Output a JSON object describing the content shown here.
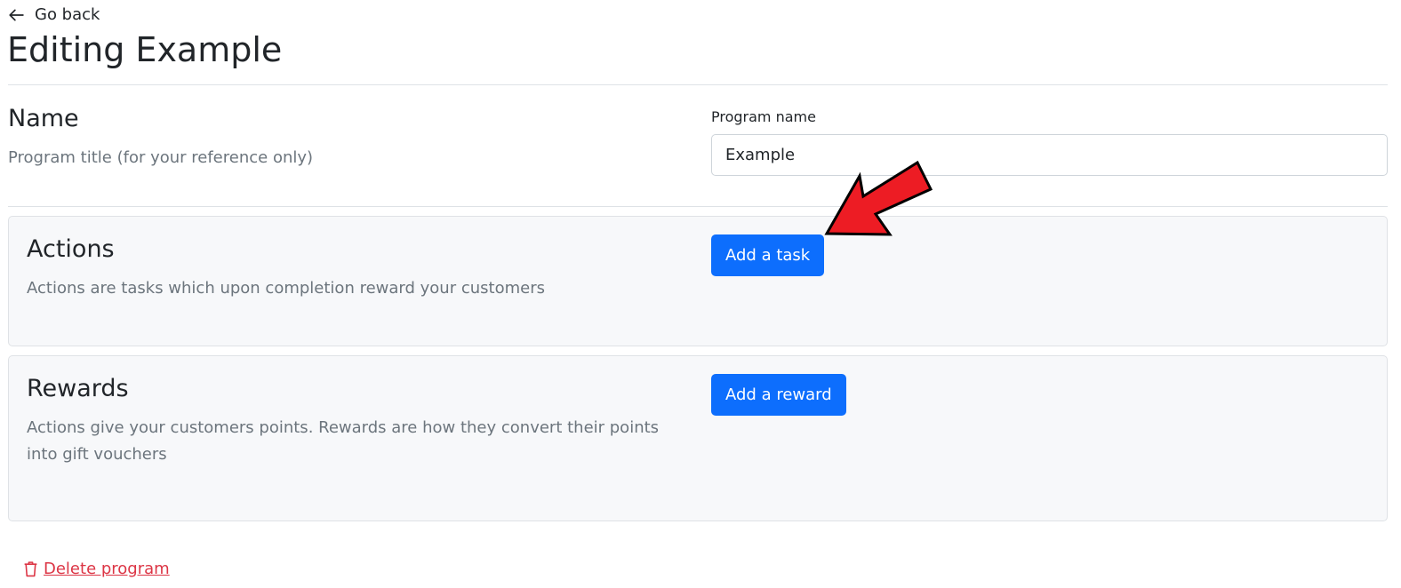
{
  "nav": {
    "back_label": "Go back"
  },
  "header": {
    "title": "Editing Example"
  },
  "name_section": {
    "title": "Name",
    "description": "Program title (for your reference only)",
    "field_label": "Program name",
    "field_value": "Example"
  },
  "actions_section": {
    "title": "Actions",
    "description": "Actions are tasks which upon completion reward your customers",
    "button_label": "Add a task"
  },
  "rewards_section": {
    "title": "Rewards",
    "description": "Actions give your customers points. Rewards are how they convert their points into gift vouchers",
    "button_label": "Add a reward"
  },
  "footer": {
    "delete_label": "Delete program"
  },
  "colors": {
    "primary": "#0d6efd",
    "danger": "#dc3545",
    "card_bg": "#f7f8fa",
    "annotation_arrow": "#ed1c24"
  },
  "icons": {
    "back": "arrow-left-icon",
    "delete": "trash-icon",
    "annotation": "red-pointer-arrow"
  }
}
